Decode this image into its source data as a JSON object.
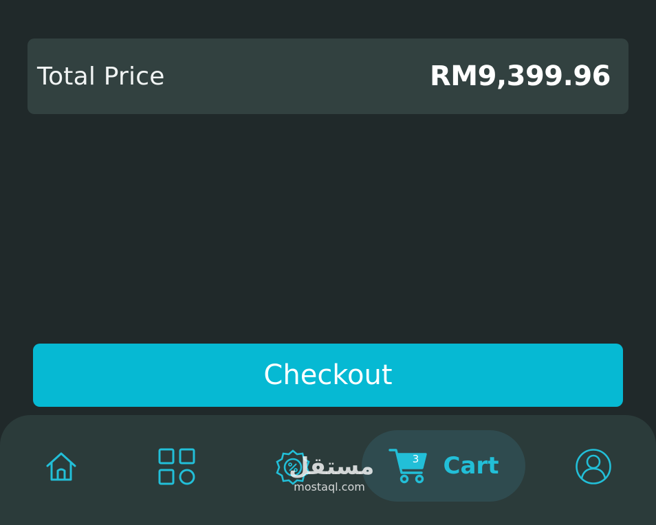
{
  "summary": {
    "total_label": "Total Price",
    "total_value": "RM9,399.96"
  },
  "checkout": {
    "label": "Checkout"
  },
  "nav": {
    "home_icon": "home-icon",
    "categories_icon": "categories-grid-icon",
    "deals_icon": "discount-badge-icon",
    "cart_label": "Cart",
    "cart_count": "3",
    "profile_icon": "profile-icon",
    "accent_color": "#22bfd8"
  },
  "watermark": {
    "arabic": "مستقل",
    "latin": "mostaql.com"
  },
  "colors": {
    "background": "#20292a",
    "card": "#324140",
    "button": "#06b9d3",
    "nav_bar": "#2b3b3a",
    "active_pill": "#2f4b4f"
  }
}
